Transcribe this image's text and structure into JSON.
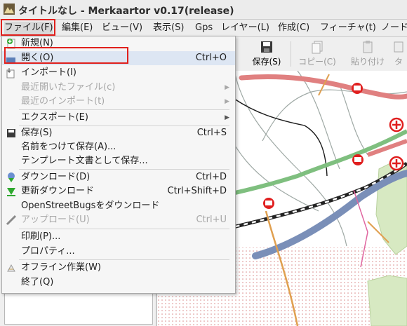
{
  "window": {
    "title": "タイトルなし - Merkaartor v0.17(release)"
  },
  "menubar": {
    "items": [
      {
        "label": "ファイル(F)"
      },
      {
        "label": "編集(E)"
      },
      {
        "label": "ビュー(V)"
      },
      {
        "label": "表示(S)"
      },
      {
        "label": "Gps"
      },
      {
        "label": "レイヤー(L)"
      },
      {
        "label": "作成(C)"
      },
      {
        "label": "フィーチャ(t)"
      },
      {
        "label": "ノード"
      }
    ]
  },
  "toolbar": {
    "save": "保存(S)",
    "copy": "コピー(C)",
    "paste": "貼り付け",
    "extra": "タ"
  },
  "file_menu": {
    "new": {
      "label": "新規(N)"
    },
    "open": {
      "label": "開く(O)",
      "shortcut": "Ctrl+O"
    },
    "import": {
      "label": "インポート(I)"
    },
    "recent_files": {
      "label": "最近開いたファイル(c)"
    },
    "recent_imports": {
      "label": "最近のインポート(t)"
    },
    "export": {
      "label": "エクスポート(E)"
    },
    "save": {
      "label": "保存(S)",
      "shortcut": "Ctrl+S"
    },
    "save_as": {
      "label": "名前をつけて保存(A)..."
    },
    "save_template": {
      "label": "テンプレート文書として保存..."
    },
    "download": {
      "label": "ダウンロード(D)",
      "shortcut": "Ctrl+D"
    },
    "update_download": {
      "label": "更新ダウンロード",
      "shortcut": "Ctrl+Shift+D"
    },
    "osb_download": {
      "label": "OpenStreetBugsをダウンロード"
    },
    "upload": {
      "label": "アップロード(U)",
      "shortcut": "Ctrl+U"
    },
    "print": {
      "label": "印刷(P)..."
    },
    "properties": {
      "label": "プロパティ..."
    },
    "offline": {
      "label": "オフライン作業(W)"
    },
    "quit": {
      "label": "終了(Q)"
    }
  },
  "colors": {
    "highlight_frame": "#e0201c",
    "menu_highlight": "#dde6f3",
    "road_primary": "#e08080",
    "road_secondary": "#7fbf7f",
    "motorway": "#7a8fb8",
    "path": "#e0a050"
  }
}
